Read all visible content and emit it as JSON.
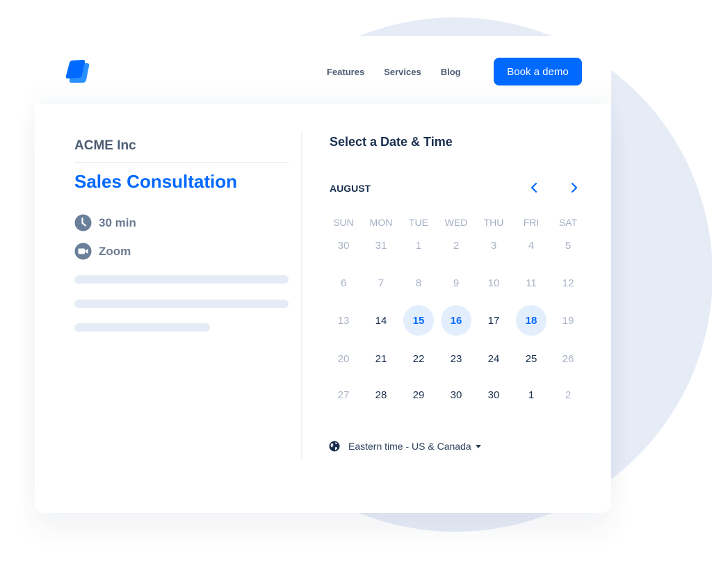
{
  "header": {
    "logo": "brand-logo",
    "nav": [
      {
        "label": "Features"
      },
      {
        "label": "Services"
      },
      {
        "label": "Blog"
      }
    ],
    "cta_label": "Book a demo"
  },
  "event": {
    "company": "ACME Inc",
    "title": "Sales Consultation",
    "duration": "30 min",
    "location": "Zoom",
    "duration_icon": "clock-icon",
    "location_icon": "video-camera-icon"
  },
  "picker": {
    "title": "Select a Date & Time",
    "month": "AUGUST",
    "prev_icon": "chevron-left-icon",
    "next_icon": "chevron-right-icon",
    "weekdays": [
      "SUN",
      "MON",
      "TUE",
      "WED",
      "THU",
      "FRI",
      "SAT"
    ],
    "weeks": [
      [
        {
          "d": "30",
          "s": "off"
        },
        {
          "d": "31",
          "s": "off"
        },
        {
          "d": "1",
          "s": "off"
        },
        {
          "d": "2",
          "s": "off"
        },
        {
          "d": "3",
          "s": "off"
        },
        {
          "d": "4",
          "s": "off"
        },
        {
          "d": "5",
          "s": "off"
        }
      ],
      [
        {
          "d": "6",
          "s": "off"
        },
        {
          "d": "7",
          "s": "off"
        },
        {
          "d": "8",
          "s": "off"
        },
        {
          "d": "9",
          "s": "off"
        },
        {
          "d": "10",
          "s": "off"
        },
        {
          "d": "11",
          "s": "off"
        },
        {
          "d": "12",
          "s": "off"
        }
      ],
      [
        {
          "d": "13",
          "s": "off"
        },
        {
          "d": "14",
          "s": "avail"
        },
        {
          "d": "15",
          "s": "sel"
        },
        {
          "d": "16",
          "s": "sel"
        },
        {
          "d": "17",
          "s": "avail"
        },
        {
          "d": "18",
          "s": "sel"
        },
        {
          "d": "19",
          "s": "off"
        }
      ],
      [
        {
          "d": "20",
          "s": "off"
        },
        {
          "d": "21",
          "s": "avail"
        },
        {
          "d": "22",
          "s": "avail"
        },
        {
          "d": "23",
          "s": "avail"
        },
        {
          "d": "24",
          "s": "avail"
        },
        {
          "d": "25",
          "s": "avail"
        },
        {
          "d": "26",
          "s": "off"
        }
      ],
      [
        {
          "d": "27",
          "s": "off"
        },
        {
          "d": "28",
          "s": "avail"
        },
        {
          "d": "29",
          "s": "avail"
        },
        {
          "d": "30",
          "s": "avail"
        },
        {
          "d": "30",
          "s": "avail"
        },
        {
          "d": "1",
          "s": "avail"
        },
        {
          "d": "2",
          "s": "off"
        }
      ]
    ],
    "timezone": "Eastern time - US & Canada",
    "timezone_icon": "globe-icon"
  },
  "colors": {
    "brand": "#0069FF",
    "highlight_bg": "#E3EEFD",
    "heading": "#1A3050",
    "muted": "#A9B3C7",
    "background_shape": "#E6ECF6"
  }
}
